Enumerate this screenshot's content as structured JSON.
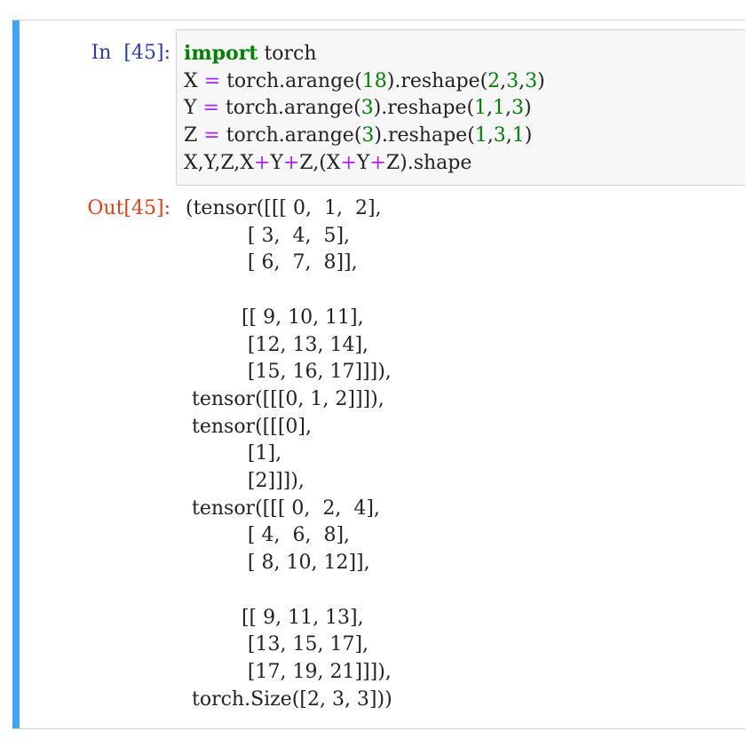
{
  "cell": {
    "in_prompt": "In  [45]:",
    "out_prompt": "Out[45]:",
    "accent_color": "#42a5f5",
    "code_lines": [
      [
        {
          "t": "import",
          "c": "kw"
        },
        {
          "t": " torch",
          "c": ""
        }
      ],
      [
        {
          "t": "X ",
          "c": ""
        },
        {
          "t": "=",
          "c": "op"
        },
        {
          "t": " torch.arange(",
          "c": ""
        },
        {
          "t": "18",
          "c": "num"
        },
        {
          "t": ").reshape(",
          "c": ""
        },
        {
          "t": "2",
          "c": "num"
        },
        {
          "t": ",",
          "c": ""
        },
        {
          "t": "3",
          "c": "num"
        },
        {
          "t": ",",
          "c": ""
        },
        {
          "t": "3",
          "c": "num"
        },
        {
          "t": ")",
          "c": ""
        }
      ],
      [
        {
          "t": "Y ",
          "c": ""
        },
        {
          "t": "=",
          "c": "op"
        },
        {
          "t": " torch.arange(",
          "c": ""
        },
        {
          "t": "3",
          "c": "num"
        },
        {
          "t": ").reshape(",
          "c": ""
        },
        {
          "t": "1",
          "c": "num"
        },
        {
          "t": ",",
          "c": ""
        },
        {
          "t": "1",
          "c": "num"
        },
        {
          "t": ",",
          "c": ""
        },
        {
          "t": "3",
          "c": "num"
        },
        {
          "t": ")",
          "c": ""
        }
      ],
      [
        {
          "t": "Z ",
          "c": ""
        },
        {
          "t": "=",
          "c": "op"
        },
        {
          "t": " torch.arange(",
          "c": ""
        },
        {
          "t": "3",
          "c": "num"
        },
        {
          "t": ").reshape(",
          "c": ""
        },
        {
          "t": "1",
          "c": "num"
        },
        {
          "t": ",",
          "c": ""
        },
        {
          "t": "3",
          "c": "num"
        },
        {
          "t": ",",
          "c": ""
        },
        {
          "t": "1",
          "c": "num"
        },
        {
          "t": ")",
          "c": ""
        }
      ],
      [
        {
          "t": "X,Y,Z,X",
          "c": ""
        },
        {
          "t": "+",
          "c": "op"
        },
        {
          "t": "Y",
          "c": ""
        },
        {
          "t": "+",
          "c": "op"
        },
        {
          "t": "Z,(X",
          "c": ""
        },
        {
          "t": "+",
          "c": "op"
        },
        {
          "t": "Y",
          "c": ""
        },
        {
          "t": "+",
          "c": "op"
        },
        {
          "t": "Z).shape",
          "c": ""
        }
      ]
    ],
    "output_text": "(tensor([[[ 0,  1,  2],\n          [ 3,  4,  5],\n          [ 6,  7,  8]],\n\n         [[ 9, 10, 11],\n          [12, 13, 14],\n          [15, 16, 17]]]),\n tensor([[[0, 1, 2]]]),\n tensor([[[0],\n          [1],\n          [2]]]),\n tensor([[[ 0,  2,  4],\n          [ 4,  6,  8],\n          [ 8, 10, 12]],\n\n         [[ 9, 11, 13],\n          [13, 15, 17],\n          [17, 19, 21]]]),\n torch.Size([2, 3, 3]))"
  }
}
